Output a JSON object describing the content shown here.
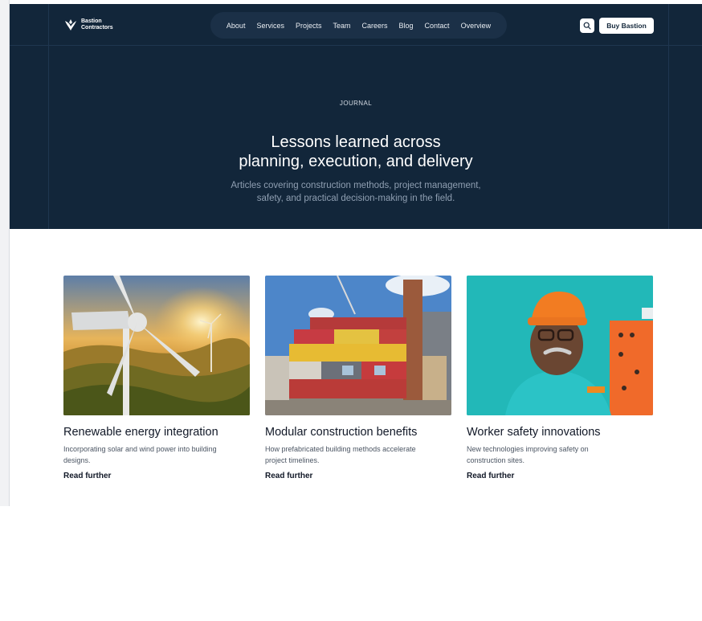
{
  "brand": {
    "line1": "Bastion",
    "line2": "Contractors"
  },
  "nav": {
    "items": [
      "About",
      "Services",
      "Projects",
      "Team",
      "Careers",
      "Blog",
      "Contact",
      "Overview"
    ]
  },
  "header": {
    "buy_label": "Buy Bastion"
  },
  "hero": {
    "eyebrow": "JOURNAL",
    "title_line1": "Lessons learned across",
    "title_line2": "planning, execution, and delivery",
    "sub_line1": "Articles covering construction methods, project management,",
    "sub_line2": "safety, and practical decision-making in the field."
  },
  "cards": [
    {
      "title": "Renewable energy integration",
      "desc_line1": "Incorporating solar and wind power into building",
      "desc_line2": "designs.",
      "link": "Read further"
    },
    {
      "title": "Modular construction benefits",
      "desc_line1": "How prefabricated building methods accelerate",
      "desc_line2": "project timelines.",
      "link": "Read further"
    },
    {
      "title": "Worker safety innovations",
      "desc_line1": "New technologies improving safety on",
      "desc_line2": "construction sites.",
      "link": "Read further"
    }
  ],
  "colors": {
    "hero_bg": "#12263a",
    "nav_bg": "#1b3047",
    "text_dark": "#111827"
  },
  "icons": {
    "logo": "bird-logo-icon",
    "search": "search-icon"
  }
}
